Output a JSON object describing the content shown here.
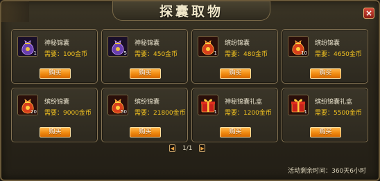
{
  "window": {
    "title": "探囊取物",
    "close_label": "×"
  },
  "items": [
    {
      "name": "神秘锦囊",
      "price": "需要：100金币",
      "count": "1",
      "icon": "purple-bag-icon",
      "buy_label": "购买"
    },
    {
      "name": "神秘锦囊",
      "price": "需要：450金币",
      "count": "5",
      "icon": "purple-bag-icon",
      "buy_label": "购买"
    },
    {
      "name": "缤纷锦囊",
      "price": "需要：480金币",
      "count": "1",
      "icon": "red-bag-icon",
      "buy_label": "购买"
    },
    {
      "name": "缤纷锦囊",
      "price": "需要：4650金币",
      "count": "10",
      "icon": "red-bag-icon",
      "buy_label": "购买"
    },
    {
      "name": "缤纷锦囊",
      "price": "需要：9000金币",
      "count": "20",
      "icon": "red-bag-icon",
      "buy_label": "购买"
    },
    {
      "name": "缤纷锦囊",
      "price": "需要：21800金币",
      "count": "50",
      "icon": "red-bag-icon",
      "buy_label": "购买"
    },
    {
      "name": "神秘锦囊礼盒",
      "price": "需要：1200金币",
      "count": "1",
      "icon": "red-gift-box-icon",
      "buy_label": "购买"
    },
    {
      "name": "缤纷锦囊礼盒",
      "price": "需要：5500金币",
      "count": "1",
      "icon": "red-gift-box-icon",
      "buy_label": "购买"
    }
  ],
  "pager": {
    "prev": "◀",
    "next": "▶",
    "text": "1/1"
  },
  "activity": {
    "text": "活动剩余时间：360天6小时"
  },
  "colors": {
    "price": "#f0c020",
    "button": "#f08a10",
    "border": "#857454"
  }
}
